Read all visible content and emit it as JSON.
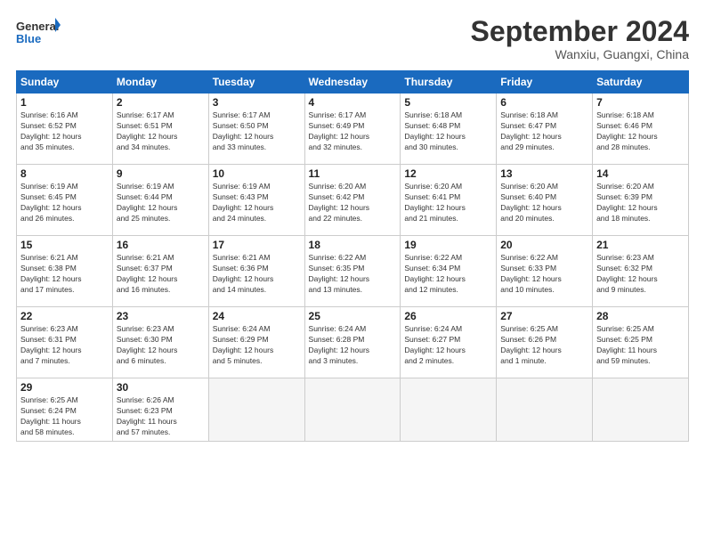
{
  "header": {
    "logo_line1": "General",
    "logo_line2": "Blue",
    "month_title": "September 2024",
    "location": "Wanxiu, Guangxi, China"
  },
  "days_of_week": [
    "Sunday",
    "Monday",
    "Tuesday",
    "Wednesday",
    "Thursday",
    "Friday",
    "Saturday"
  ],
  "weeks": [
    [
      {
        "day": "1",
        "info": "Sunrise: 6:16 AM\nSunset: 6:52 PM\nDaylight: 12 hours\nand 35 minutes."
      },
      {
        "day": "2",
        "info": "Sunrise: 6:17 AM\nSunset: 6:51 PM\nDaylight: 12 hours\nand 34 minutes."
      },
      {
        "day": "3",
        "info": "Sunrise: 6:17 AM\nSunset: 6:50 PM\nDaylight: 12 hours\nand 33 minutes."
      },
      {
        "day": "4",
        "info": "Sunrise: 6:17 AM\nSunset: 6:49 PM\nDaylight: 12 hours\nand 32 minutes."
      },
      {
        "day": "5",
        "info": "Sunrise: 6:18 AM\nSunset: 6:48 PM\nDaylight: 12 hours\nand 30 minutes."
      },
      {
        "day": "6",
        "info": "Sunrise: 6:18 AM\nSunset: 6:47 PM\nDaylight: 12 hours\nand 29 minutes."
      },
      {
        "day": "7",
        "info": "Sunrise: 6:18 AM\nSunset: 6:46 PM\nDaylight: 12 hours\nand 28 minutes."
      }
    ],
    [
      {
        "day": "8",
        "info": "Sunrise: 6:19 AM\nSunset: 6:45 PM\nDaylight: 12 hours\nand 26 minutes."
      },
      {
        "day": "9",
        "info": "Sunrise: 6:19 AM\nSunset: 6:44 PM\nDaylight: 12 hours\nand 25 minutes."
      },
      {
        "day": "10",
        "info": "Sunrise: 6:19 AM\nSunset: 6:43 PM\nDaylight: 12 hours\nand 24 minutes."
      },
      {
        "day": "11",
        "info": "Sunrise: 6:20 AM\nSunset: 6:42 PM\nDaylight: 12 hours\nand 22 minutes."
      },
      {
        "day": "12",
        "info": "Sunrise: 6:20 AM\nSunset: 6:41 PM\nDaylight: 12 hours\nand 21 minutes."
      },
      {
        "day": "13",
        "info": "Sunrise: 6:20 AM\nSunset: 6:40 PM\nDaylight: 12 hours\nand 20 minutes."
      },
      {
        "day": "14",
        "info": "Sunrise: 6:20 AM\nSunset: 6:39 PM\nDaylight: 12 hours\nand 18 minutes."
      }
    ],
    [
      {
        "day": "15",
        "info": "Sunrise: 6:21 AM\nSunset: 6:38 PM\nDaylight: 12 hours\nand 17 minutes."
      },
      {
        "day": "16",
        "info": "Sunrise: 6:21 AM\nSunset: 6:37 PM\nDaylight: 12 hours\nand 16 minutes."
      },
      {
        "day": "17",
        "info": "Sunrise: 6:21 AM\nSunset: 6:36 PM\nDaylight: 12 hours\nand 14 minutes."
      },
      {
        "day": "18",
        "info": "Sunrise: 6:22 AM\nSunset: 6:35 PM\nDaylight: 12 hours\nand 13 minutes."
      },
      {
        "day": "19",
        "info": "Sunrise: 6:22 AM\nSunset: 6:34 PM\nDaylight: 12 hours\nand 12 minutes."
      },
      {
        "day": "20",
        "info": "Sunrise: 6:22 AM\nSunset: 6:33 PM\nDaylight: 12 hours\nand 10 minutes."
      },
      {
        "day": "21",
        "info": "Sunrise: 6:23 AM\nSunset: 6:32 PM\nDaylight: 12 hours\nand 9 minutes."
      }
    ],
    [
      {
        "day": "22",
        "info": "Sunrise: 6:23 AM\nSunset: 6:31 PM\nDaylight: 12 hours\nand 7 minutes."
      },
      {
        "day": "23",
        "info": "Sunrise: 6:23 AM\nSunset: 6:30 PM\nDaylight: 12 hours\nand 6 minutes."
      },
      {
        "day": "24",
        "info": "Sunrise: 6:24 AM\nSunset: 6:29 PM\nDaylight: 12 hours\nand 5 minutes."
      },
      {
        "day": "25",
        "info": "Sunrise: 6:24 AM\nSunset: 6:28 PM\nDaylight: 12 hours\nand 3 minutes."
      },
      {
        "day": "26",
        "info": "Sunrise: 6:24 AM\nSunset: 6:27 PM\nDaylight: 12 hours\nand 2 minutes."
      },
      {
        "day": "27",
        "info": "Sunrise: 6:25 AM\nSunset: 6:26 PM\nDaylight: 12 hours\nand 1 minute."
      },
      {
        "day": "28",
        "info": "Sunrise: 6:25 AM\nSunset: 6:25 PM\nDaylight: 11 hours\nand 59 minutes."
      }
    ],
    [
      {
        "day": "29",
        "info": "Sunrise: 6:25 AM\nSunset: 6:24 PM\nDaylight: 11 hours\nand 58 minutes."
      },
      {
        "day": "30",
        "info": "Sunrise: 6:26 AM\nSunset: 6:23 PM\nDaylight: 11 hours\nand 57 minutes."
      },
      {
        "day": "",
        "info": ""
      },
      {
        "day": "",
        "info": ""
      },
      {
        "day": "",
        "info": ""
      },
      {
        "day": "",
        "info": ""
      },
      {
        "day": "",
        "info": ""
      }
    ]
  ]
}
